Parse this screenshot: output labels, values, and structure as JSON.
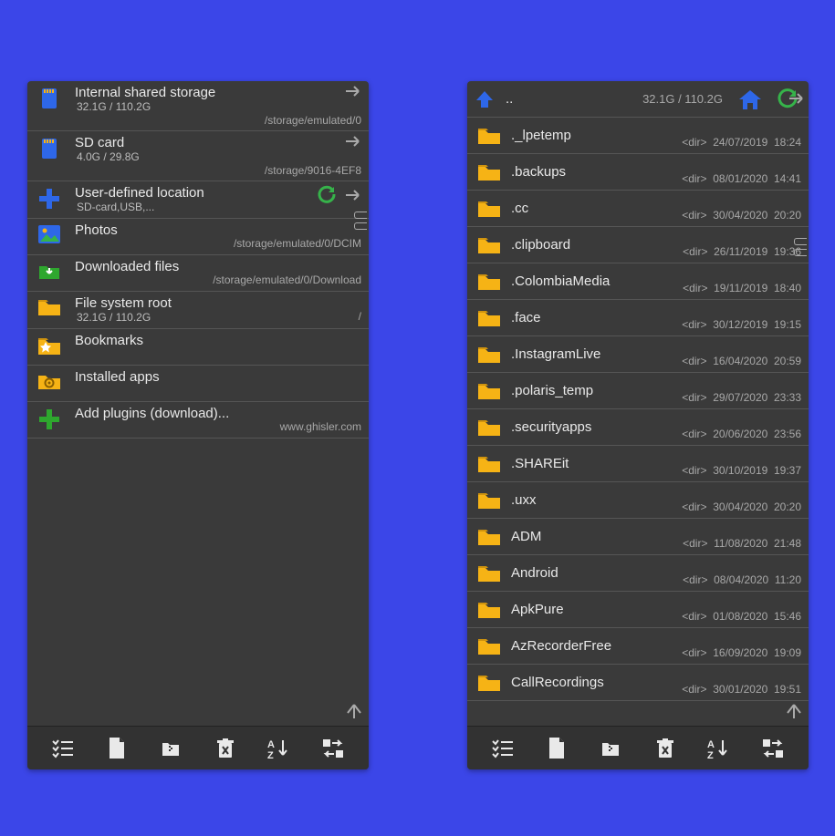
{
  "left": {
    "locations": [
      {
        "icon": "sd-blue",
        "title": "Internal shared storage",
        "sub": "32.1G / 110.2G",
        "path": "/storage/emulated/0",
        "arrow": true
      },
      {
        "icon": "sd-blue",
        "title": "SD card",
        "sub": "4.0G / 29.8G",
        "path": "/storage/9016-4EF8",
        "arrow": true
      },
      {
        "icon": "plus-blue",
        "title": "User-defined location",
        "sub": "SD-card,USB,...",
        "refresh": true,
        "arrow": true
      },
      {
        "icon": "photo",
        "title": "Photos",
        "path": "/storage/emulated/0/DCIM"
      },
      {
        "icon": "download-green",
        "title": "Downloaded files",
        "path": "/storage/emulated/0/Download"
      },
      {
        "icon": "folder-yellow",
        "title": "File system root",
        "sub": "32.1G / 110.2G",
        "path": "/"
      },
      {
        "icon": "bookmark",
        "title": "Bookmarks"
      },
      {
        "icon": "folder-gear",
        "title": "Installed apps"
      },
      {
        "icon": "plus-green",
        "title": "Add plugins (download)...",
        "path": "www.ghisler.com"
      }
    ]
  },
  "right": {
    "header": {
      "parent": "..",
      "storage": "32.1G / 110.2G"
    },
    "files": [
      {
        "name": "._lpetemp",
        "type": "<dir>",
        "date": "24/07/2019",
        "time": "18:24"
      },
      {
        "name": ".backups",
        "type": "<dir>",
        "date": "08/01/2020",
        "time": "14:41"
      },
      {
        "name": ".cc",
        "type": "<dir>",
        "date": "30/04/2020",
        "time": "20:20"
      },
      {
        "name": ".clipboard",
        "type": "<dir>",
        "date": "26/11/2019",
        "time": "19:36"
      },
      {
        "name": ".ColombiaMedia",
        "type": "<dir>",
        "date": "19/11/2019",
        "time": "18:40"
      },
      {
        "name": ".face",
        "type": "<dir>",
        "date": "30/12/2019",
        "time": "19:15"
      },
      {
        "name": ".InstagramLive",
        "type": "<dir>",
        "date": "16/04/2020",
        "time": "20:59"
      },
      {
        "name": ".polaris_temp",
        "type": "<dir>",
        "date": "29/07/2020",
        "time": "23:33"
      },
      {
        "name": ".securityapps",
        "type": "<dir>",
        "date": "20/06/2020",
        "time": "23:56"
      },
      {
        "name": ".SHAREit",
        "type": "<dir>",
        "date": "30/10/2019",
        "time": "19:37"
      },
      {
        "name": ".uxx",
        "type": "<dir>",
        "date": "30/04/2020",
        "time": "20:20"
      },
      {
        "name": "ADM",
        "type": "<dir>",
        "date": "11/08/2020",
        "time": "21:48"
      },
      {
        "name": "Android",
        "type": "<dir>",
        "date": "08/04/2020",
        "time": "11:20"
      },
      {
        "name": "ApkPure",
        "type": "<dir>",
        "date": "01/08/2020",
        "time": "15:46"
      },
      {
        "name": "AzRecorderFree",
        "type": "<dir>",
        "date": "16/09/2020",
        "time": "19:09"
      },
      {
        "name": "CallRecordings",
        "type": "<dir>",
        "date": "30/01/2020",
        "time": "19:51"
      }
    ]
  }
}
